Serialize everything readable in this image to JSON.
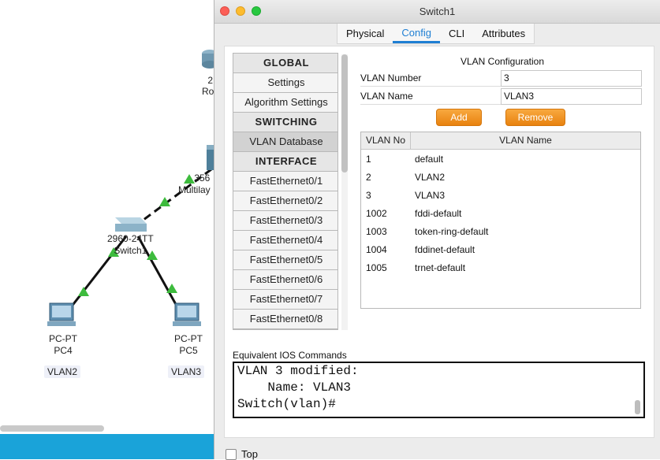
{
  "topology": {
    "devices": [
      {
        "id": "router",
        "label_lines": [
          "2",
          "Ro"
        ]
      },
      {
        "id": "multilayer",
        "label_lines": [
          "356",
          "Multilay"
        ]
      },
      {
        "id": "switch1",
        "label_lines": [
          "2960-24TT",
          "Switch1"
        ]
      },
      {
        "id": "pc4",
        "label_lines": [
          "PC-PT",
          "PC4"
        ],
        "vlan": "VLAN2"
      },
      {
        "id": "pc5",
        "label_lines": [
          "PC-PT",
          "PC5"
        ],
        "vlan": "VLAN3"
      }
    ],
    "colors": {
      "link": "#111111",
      "link_up": "#3dbb3d",
      "status_bar": "#1aa3d9"
    }
  },
  "window": {
    "title": "Switch1",
    "tabs": [
      {
        "label": "Physical",
        "active": false
      },
      {
        "label": "Config",
        "active": true
      },
      {
        "label": "CLI",
        "active": false
      },
      {
        "label": "Attributes",
        "active": false
      }
    ]
  },
  "nav": {
    "items": [
      {
        "label": "GLOBAL",
        "type": "header"
      },
      {
        "label": "Settings",
        "type": "item"
      },
      {
        "label": "Algorithm Settings",
        "type": "item"
      },
      {
        "label": "SWITCHING",
        "type": "header"
      },
      {
        "label": "VLAN Database",
        "type": "item",
        "selected": true
      },
      {
        "label": "INTERFACE",
        "type": "header"
      },
      {
        "label": "FastEthernet0/1",
        "type": "item"
      },
      {
        "label": "FastEthernet0/2",
        "type": "item"
      },
      {
        "label": "FastEthernet0/3",
        "type": "item"
      },
      {
        "label": "FastEthernet0/4",
        "type": "item"
      },
      {
        "label": "FastEthernet0/5",
        "type": "item"
      },
      {
        "label": "FastEthernet0/6",
        "type": "item"
      },
      {
        "label": "FastEthernet0/7",
        "type": "item"
      },
      {
        "label": "FastEthernet0/8",
        "type": "item"
      }
    ]
  },
  "vlan_config": {
    "title": "VLAN Configuration",
    "number_label": "VLAN Number",
    "number_value": "3",
    "name_label": "VLAN Name",
    "name_value": "VLAN3",
    "add_label": "Add",
    "remove_label": "Remove",
    "accent": "#f0931f",
    "table": {
      "headers": [
        "VLAN No",
        "VLAN Name"
      ],
      "rows": [
        [
          "1",
          "default"
        ],
        [
          "2",
          "VLAN2"
        ],
        [
          "3",
          "VLAN3"
        ],
        [
          "1002",
          "fddi-default"
        ],
        [
          "1003",
          "token-ring-default"
        ],
        [
          "1004",
          "fddinet-default"
        ],
        [
          "1005",
          "trnet-default"
        ]
      ]
    }
  },
  "ios": {
    "label": "Equivalent IOS Commands",
    "lines": [
      "VLAN 3 modified:",
      "    Name: VLAN3",
      "Switch(vlan)#"
    ]
  },
  "footer": {
    "top_label": "Top",
    "top_checked": false
  }
}
